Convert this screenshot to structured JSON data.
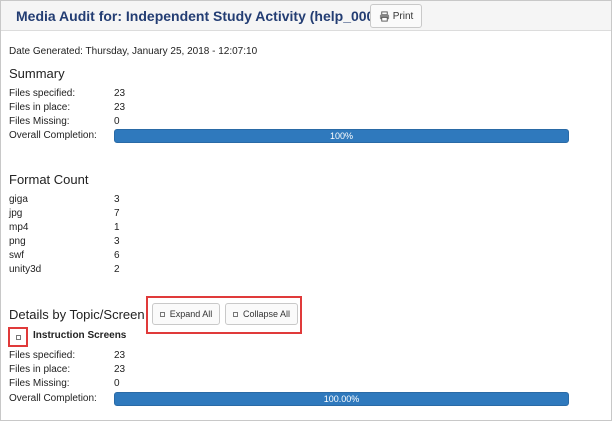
{
  "header": {
    "title": "Media Audit for: Independent Study Activity (help_00018)",
    "print_label": "Print"
  },
  "date_generated": "Date Generated: Thursday, January 25, 2018 - 12:07:10",
  "summary": {
    "title": "Summary",
    "rows": [
      {
        "label": "Files specified:",
        "value": "23"
      },
      {
        "label": "Files in place:",
        "value": "23"
      },
      {
        "label": "Files Missing:",
        "value": "0"
      }
    ],
    "completion_label": "Overall Completion:",
    "completion_text": "100%",
    "completion_fraction": 1.0
  },
  "format_count": {
    "title": "Format Count",
    "rows": [
      {
        "label": "giga",
        "value": "3"
      },
      {
        "label": "jpg",
        "value": "7"
      },
      {
        "label": "mp4",
        "value": "1"
      },
      {
        "label": "png",
        "value": "3"
      },
      {
        "label": "swf",
        "value": "6"
      },
      {
        "label": "unity3d",
        "value": "2"
      }
    ]
  },
  "details": {
    "title": "Details by Topic/Screen",
    "expand_label": "Expand All",
    "collapse_label": "Collapse All",
    "group_title": "Instruction Screens",
    "rows": [
      {
        "label": "Files specified:",
        "value": "23"
      },
      {
        "label": "Files in place:",
        "value": "23"
      },
      {
        "label": "Files Missing:",
        "value": "0"
      }
    ],
    "completion_label": "Overall Completion:",
    "completion_text": "100.00%",
    "completion_fraction": 1.0
  },
  "colors": {
    "title": "#233d73",
    "progress": "#2f79bd",
    "highlight": "#e03a3a"
  }
}
